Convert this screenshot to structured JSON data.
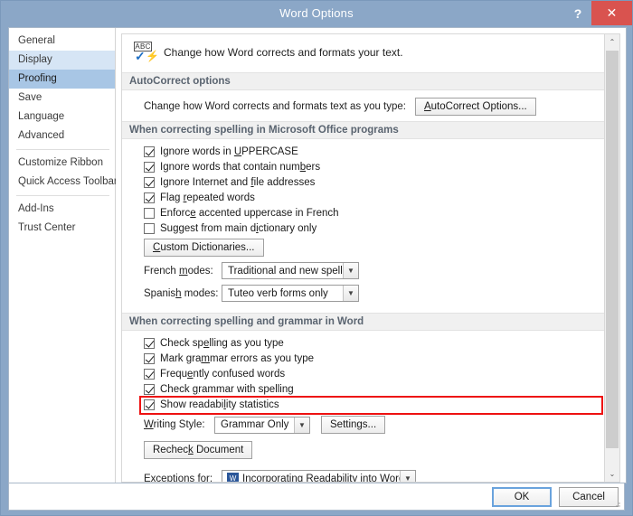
{
  "window": {
    "title": "Word Options",
    "help_label": "?",
    "close_label": "✕"
  },
  "sidebar": {
    "items": [
      {
        "label": "General",
        "state": "normal"
      },
      {
        "label": "Display",
        "state": "hover"
      },
      {
        "label": "Proofing",
        "state": "active"
      },
      {
        "label": "Save",
        "state": "normal"
      },
      {
        "label": "Language",
        "state": "normal"
      },
      {
        "label": "Advanced",
        "state": "normal"
      },
      {
        "label": "Customize Ribbon",
        "state": "normal"
      },
      {
        "label": "Quick Access Toolbar",
        "state": "normal"
      },
      {
        "label": "Add-Ins",
        "state": "normal"
      },
      {
        "label": "Trust Center",
        "state": "normal"
      }
    ]
  },
  "content": {
    "header": {
      "icon": "abc-spellcheck-icon",
      "icon_text": "ABC",
      "text": "Change how Word corrects and formats your text."
    },
    "autocorrect": {
      "band": "AutoCorrect options",
      "row_label": "Change how Word corrects and formats text as you type:",
      "button": "AutoCorrect Options..."
    },
    "spelling": {
      "band": "When correcting spelling in Microsoft Office programs",
      "checkboxes": [
        {
          "pre": "Ignore words in ",
          "accel": "U",
          "post": "PPERCASE",
          "checked": true
        },
        {
          "pre": "Ignore words that contain num",
          "accel": "b",
          "post": "ers",
          "checked": true
        },
        {
          "pre": "Ignore Internet and ",
          "accel": "f",
          "post": "ile addresses",
          "checked": true
        },
        {
          "pre": "Flag ",
          "accel": "r",
          "post": "epeated words",
          "checked": true
        },
        {
          "pre": "Enforc",
          "accel": "e",
          "post": " accented uppercase in French",
          "checked": false
        },
        {
          "pre": "Suggest from main d",
          "accel": "i",
          "post": "ctionary only",
          "checked": false
        }
      ],
      "custom_dictionaries_button": "Custom Dictionaries...",
      "french_label_pre": "French ",
      "french_label_accel": "m",
      "french_label_post": "odes:",
      "french_value": "Traditional and new spellings",
      "spanish_label_pre": "Spanis",
      "spanish_label_accel": "h",
      "spanish_label_post": " modes:",
      "spanish_value": "Tuteo verb forms only"
    },
    "grammar": {
      "band": "When correcting spelling and grammar in Word",
      "checkboxes": [
        {
          "pre": "Check sp",
          "accel": "e",
          "post": "lling as you type",
          "checked": true
        },
        {
          "pre": "Mark gra",
          "accel": "m",
          "post": "mar errors as you type",
          "checked": true
        },
        {
          "pre": "Frequ",
          "accel": "e",
          "post": "ntly confused words",
          "checked": true
        },
        {
          "pre": "Check ",
          "accel": "g",
          "post": "rammar with spelling",
          "checked": true
        },
        {
          "pre": "Show readabi",
          "accel": "l",
          "post": "ity statistics",
          "checked": true,
          "highlighted": true
        }
      ],
      "writing_style_label_pre": "",
      "writing_style_label_accel": "W",
      "writing_style_label_post": "riting Style:",
      "writing_style_value": "Grammar Only",
      "settings_button": "Settings...",
      "recheck_button_pre": "Rechec",
      "recheck_button_accel": "k",
      "recheck_button_post": " Document",
      "exceptions_label": "Exceptions for:",
      "exceptions_value": "Incorporating Readability into Word.docx",
      "exceptions_icon": "word-document-icon"
    },
    "highlight_color": "#ee1111"
  },
  "footer": {
    "ok_label": "OK",
    "cancel_label": "Cancel"
  },
  "scrollbar": {
    "up_arrow": "⌃",
    "down_arrow": "⌄"
  }
}
